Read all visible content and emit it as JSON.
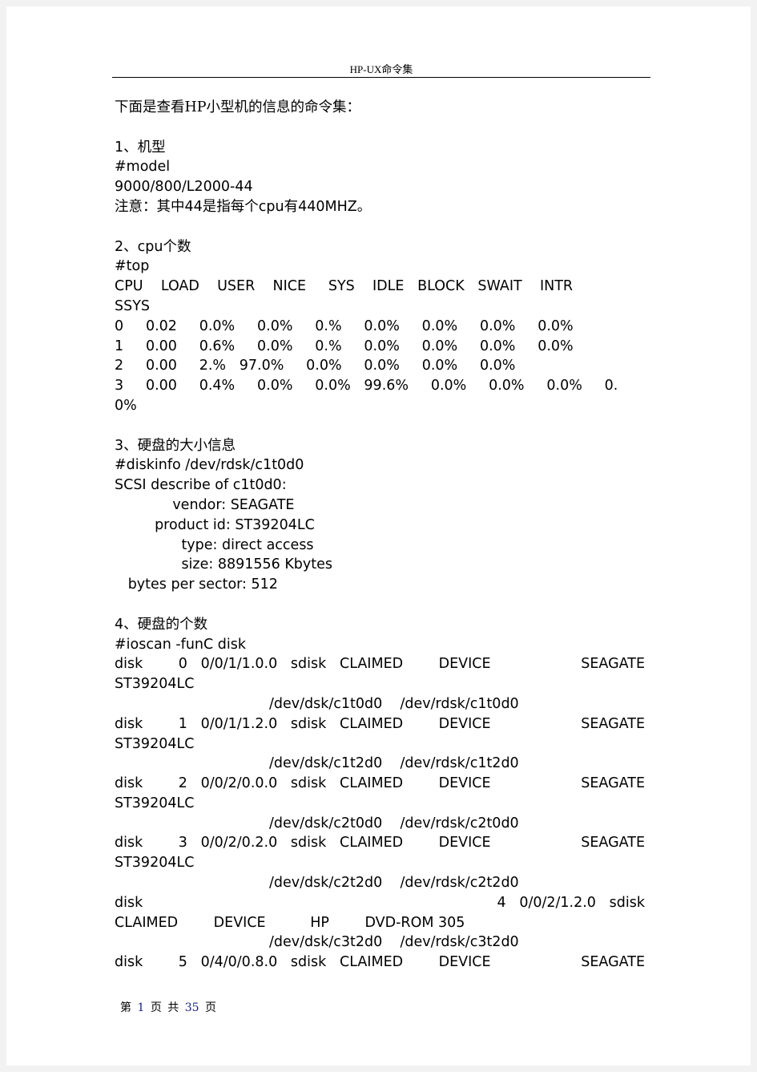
{
  "header": {
    "title": "HP-UX命令集"
  },
  "intro": "下面是查看HP小型机的信息的命令集：",
  "sections": {
    "model": {
      "heading": "1、机型",
      "command": "#model",
      "output": "9000/800/L2000-44",
      "note": "注意：其中44是指每个cpu有440MHZ。"
    },
    "cpu": {
      "heading": "2、cpu个数",
      "command": "#top",
      "table_header": "CPU    LOAD    USER    NICE     SYS    IDLE   BLOCK   SWAIT    INTR",
      "table_header_wrap": "SSYS",
      "rows": [
        "0     0.02     0.0%     0.0%     0.%     0.0%     0.0%     0.0%     0.0%",
        "1     0.00     0.6%     0.0%     0.%     0.0%     0.0%     0.0%     0.0%",
        "2     0.00     2.%   97.0%     0.0%     0.0%     0.0%     0.0%",
        "3     0.00     0.4%     0.0%     0.0%   99.6%     0.0%     0.0%     0.0%     0."
      ],
      "row_wrap": "0%"
    },
    "diskinfo": {
      "heading": "3、硬盘的大小信息",
      "command": "#diskinfo /dev/rdsk/c1t0d0",
      "lines": [
        "SCSI describe of c1t0d0:",
        "             vendor: SEAGATE",
        "         product id: ST39204LC",
        "               type: direct access",
        "               size: 8891556 Kbytes",
        "   bytes per sector: 512"
      ]
    },
    "ioscan": {
      "heading": "4、硬盘的个数",
      "command": "#ioscan -funC disk",
      "disks": [
        {
          "cls": "disk",
          "num": "0",
          "path": "0/0/1/1.0.0",
          "driver": "sdisk",
          "state": "CLAIMED",
          "type": "DEVICE",
          "vendor": "SEAGATE",
          "product": "ST39204LC",
          "devfiles": "/dev/dsk/c1t0d0    /dev/rdsk/c1t0d0"
        },
        {
          "cls": "disk",
          "num": "1",
          "path": "0/0/1/1.2.0",
          "driver": "sdisk",
          "state": "CLAIMED",
          "type": "DEVICE",
          "vendor": "SEAGATE",
          "product": "ST39204LC",
          "devfiles": "/dev/dsk/c1t2d0    /dev/rdsk/c1t2d0"
        },
        {
          "cls": "disk",
          "num": "2",
          "path": "0/0/2/0.0.0",
          "driver": "sdisk",
          "state": "CLAIMED",
          "type": "DEVICE",
          "vendor": "SEAGATE",
          "product": "ST39204LC",
          "devfiles": "/dev/dsk/c2t0d0    /dev/rdsk/c2t0d0"
        },
        {
          "cls": "disk",
          "num": "3",
          "path": "0/0/2/0.2.0",
          "driver": "sdisk",
          "state": "CLAIMED",
          "type": "DEVICE",
          "vendor": "SEAGATE",
          "product": "ST39204LC",
          "devfiles": "/dev/dsk/c2t2d0    /dev/rdsk/c2t2d0"
        },
        {
          "cls": "disk",
          "num": "4",
          "path": "0/0/2/1.2.0",
          "driver": "sdisk",
          "state": "CLAIMED",
          "type": "DEVICE",
          "vendor": "HP",
          "product": "DVD-ROM 305",
          "devfiles": "/dev/dsk/c3t2d0    /dev/rdsk/c3t2d0"
        },
        {
          "cls": "disk",
          "num": "5",
          "path": "0/4/0/0.8.0",
          "driver": "sdisk",
          "state": "CLAIMED",
          "type": "DEVICE",
          "vendor": "SEAGATE"
        }
      ]
    }
  },
  "footer": {
    "prefix": "第",
    "page": "1",
    "mid": "页 共",
    "total": "35",
    "suffix": "页"
  }
}
